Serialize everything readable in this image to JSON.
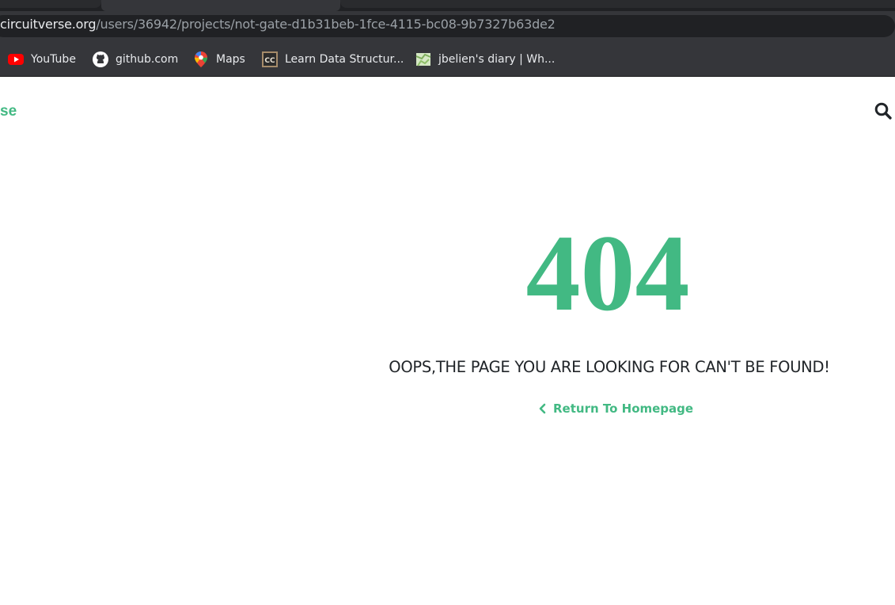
{
  "browser": {
    "url_domain": "circuitverse.org",
    "url_path": "/users/36942/projects/not-gate-d1b31beb-1fce-4115-bc08-9b7327b63de2",
    "bookmarks": [
      {
        "label": "YouTube",
        "icon": "youtube-icon"
      },
      {
        "label": "github.com",
        "icon": "github-icon"
      },
      {
        "label": "Maps",
        "icon": "maps-icon"
      },
      {
        "label": "Learn Data Structur...",
        "icon": "cc-icon"
      },
      {
        "label": "jbelien's diary | Wh...",
        "icon": "map-diary-icon"
      }
    ]
  },
  "header": {
    "brand_fragment": "se",
    "search_icon": "search-icon"
  },
  "error": {
    "code": "404",
    "message": "OOPS,THE PAGE YOU ARE LOOKING FOR CAN'T BE FOUND!",
    "return_label": "Return To Homepage"
  },
  "colors": {
    "accent": "#42b983",
    "browser_dark": "#35363a",
    "omnibox": "#202124"
  }
}
